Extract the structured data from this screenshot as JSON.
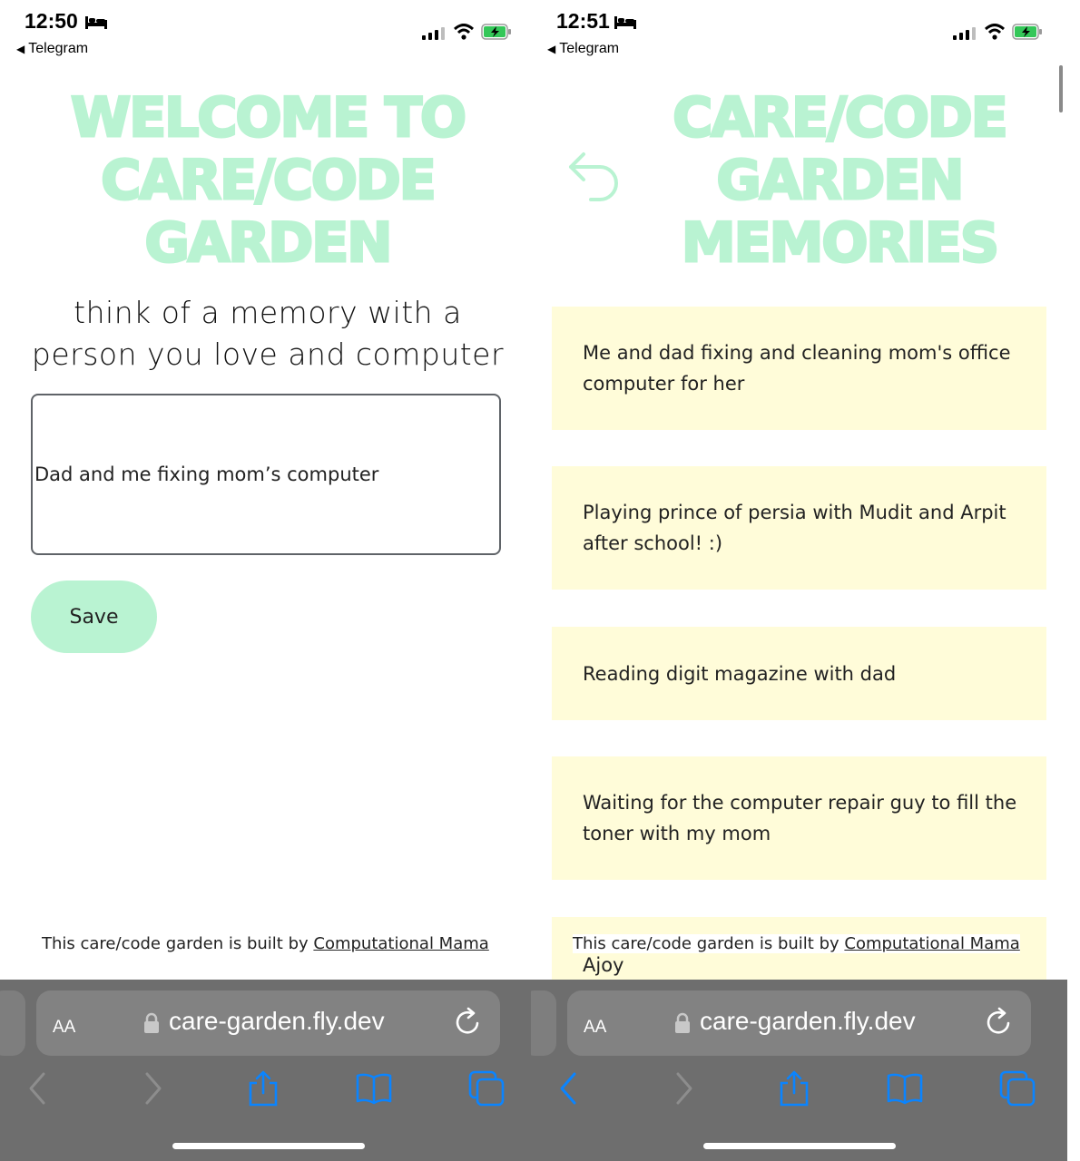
{
  "left": {
    "status": {
      "time": "12:50",
      "back_app": "Telegram"
    },
    "title": "WELCOME TO CARE/CODE GARDEN",
    "prompt": "think of a memory with a person you love and computer",
    "input_value": "Dad and me fixing mom’s computer",
    "save_label": "Save",
    "footer": {
      "text": "This care/code garden is built by ",
      "link": "Computational Mama"
    },
    "browser": {
      "aa_label": "AA",
      "url": "care-garden.fly.dev"
    }
  },
  "right": {
    "status": {
      "time": "12:51",
      "back_app": "Telegram"
    },
    "title": "CARE/CODE GARDEN MEMORIES",
    "memories": [
      "Me and dad fixing and cleaning mom's office computer for her",
      "Playing prince of persia with Mudit and Arpit after school! :)",
      "Reading digit magazine with dad",
      "Waiting for the computer repair guy to fill the toner with my mom",
      "Ajoy"
    ],
    "footer": {
      "text": "This care/code garden is built by ",
      "link": "Computational Mama"
    },
    "browser": {
      "aa_label": "AA",
      "url": "care-garden.fly.dev"
    }
  },
  "colors": {
    "title_green": "#b9f3d2",
    "card_yellow": "#fffcd9",
    "safari_gray": "#6e6e6e",
    "ios_blue": "#0a84ff",
    "battery_green": "#34c759"
  },
  "icons": [
    "bed-icon",
    "signal-icon",
    "wifi-icon",
    "battery-icon",
    "undo-icon",
    "lock-icon",
    "reload-icon",
    "back-icon",
    "forward-icon",
    "share-icon",
    "bookmarks-icon",
    "tabs-icon"
  ]
}
